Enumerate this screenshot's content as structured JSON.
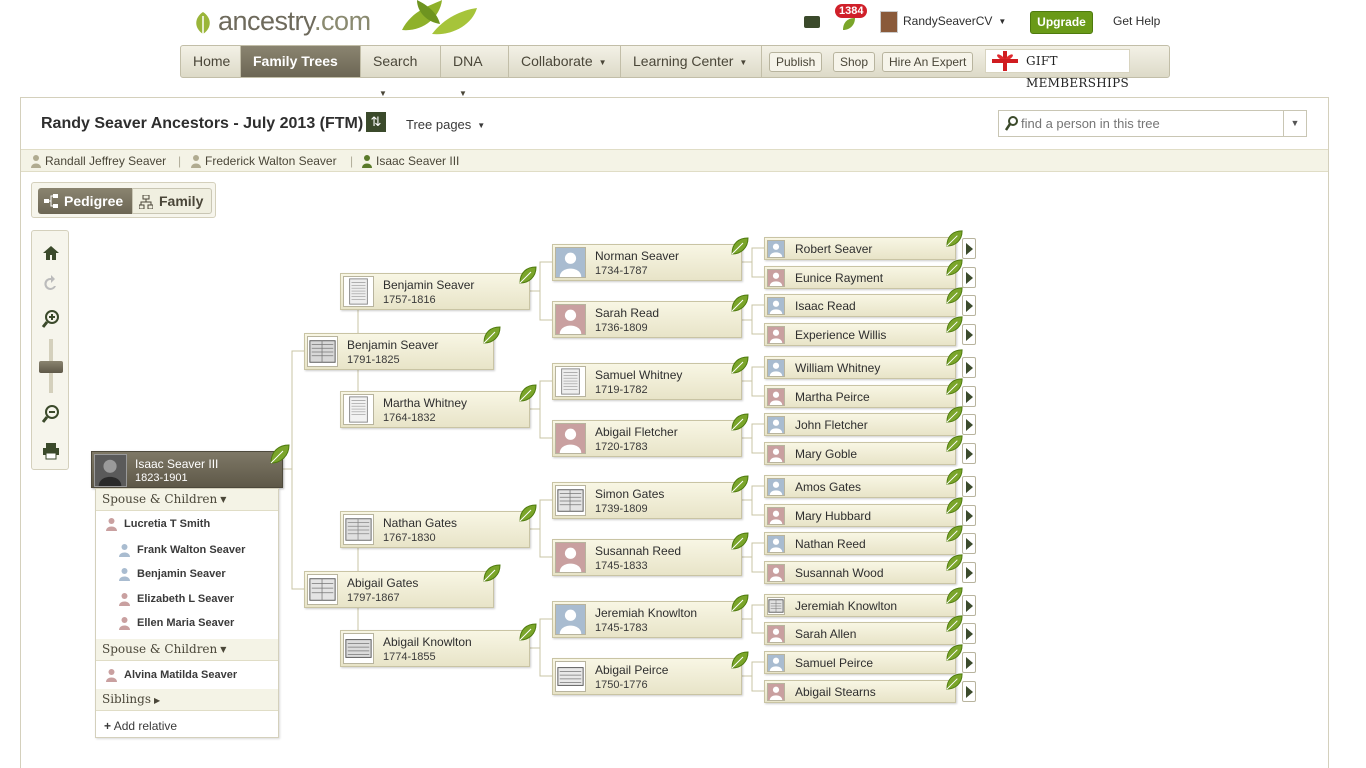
{
  "header": {
    "logo_text": "ancestry",
    "logo_suffix": ".com",
    "notifications_count": "1384",
    "username": "RandySeaverCV",
    "upgrade_label": "Upgrade",
    "help_label": "Get Help"
  },
  "nav": {
    "items": [
      {
        "label": "Home"
      },
      {
        "label": "Family Trees"
      },
      {
        "label": "Search"
      },
      {
        "label": "DNA"
      },
      {
        "label": "Collaborate"
      },
      {
        "label": "Learning Center"
      }
    ],
    "buttons": [
      {
        "label": "Publish"
      },
      {
        "label": "Shop"
      },
      {
        "label": "Hire An Expert"
      }
    ],
    "gift_label": "GIFT MEMBERSHIPS"
  },
  "tree": {
    "title": "Randy Seaver Ancestors - July 2013 (FTM)",
    "tree_pages_label": "Tree pages",
    "search_placeholder": "find a person in this tree",
    "breadcrumb": [
      "Randall Jeffrey Seaver",
      "Frederick Walton Seaver",
      "Isaac Seaver III"
    ],
    "views": {
      "pedigree": "Pedigree",
      "family": "Family"
    }
  },
  "root_person": {
    "name": "Isaac Seaver III",
    "dates": "1823-1901"
  },
  "family_panel": {
    "spouse_header_1": "Spouse & Children",
    "spouse_1": "Lucretia T Smith",
    "children_1": [
      "Frank Walton Seaver",
      "Benjamin Seaver",
      "Elizabeth L Seaver",
      "Ellen Maria Seaver"
    ],
    "spouse_header_2": "Spouse & Children",
    "spouse_2": "Alvina Matilda Seaver",
    "siblings_header": "Siblings",
    "add_relative": "Add relative"
  },
  "gen2": [
    {
      "name": "Benjamin Seaver",
      "dates": "1791-1825"
    },
    {
      "name": "Abigail Gates",
      "dates": "1797-1867"
    }
  ],
  "gen3": [
    {
      "name": "Benjamin Seaver",
      "dates": "1757-1816"
    },
    {
      "name": "Martha Whitney",
      "dates": "1764-1832"
    },
    {
      "name": "Nathan Gates",
      "dates": "1767-1830"
    },
    {
      "name": "Abigail Knowlton",
      "dates": "1774-1855"
    }
  ],
  "gen4": [
    {
      "name": "Norman Seaver",
      "dates": "1734-1787"
    },
    {
      "name": "Sarah Read",
      "dates": "1736-1809"
    },
    {
      "name": "Samuel Whitney",
      "dates": "1719-1782"
    },
    {
      "name": "Abigail Fletcher",
      "dates": "1720-1783"
    },
    {
      "name": "Simon Gates",
      "dates": "1739-1809"
    },
    {
      "name": "Susannah Reed",
      "dates": "1745-1833"
    },
    {
      "name": "Jeremiah Knowlton",
      "dates": "1745-1783"
    },
    {
      "name": "Abigail Peirce",
      "dates": "1750-1776"
    }
  ],
  "gen5": [
    {
      "name": "Robert Seaver"
    },
    {
      "name": "Eunice Rayment"
    },
    {
      "name": "Isaac Read"
    },
    {
      "name": "Experience Willis"
    },
    {
      "name": "William Whitney"
    },
    {
      "name": "Martha Peirce"
    },
    {
      "name": "John Fletcher"
    },
    {
      "name": "Mary Goble"
    },
    {
      "name": "Amos Gates"
    },
    {
      "name": "Mary Hubbard"
    },
    {
      "name": "Nathan Reed"
    },
    {
      "name": "Susannah Wood"
    },
    {
      "name": "Jeremiah Knowlton"
    },
    {
      "name": "Sarah Allen"
    },
    {
      "name": "Samuel Peirce"
    },
    {
      "name": "Abigail Stearns"
    }
  ],
  "colors": {
    "male_silhouette": "#a9bcd0",
    "female_silhouette": "#c9a0a0",
    "hint_leaf": "#7aa52a",
    "nav_active": "#6c6654"
  }
}
